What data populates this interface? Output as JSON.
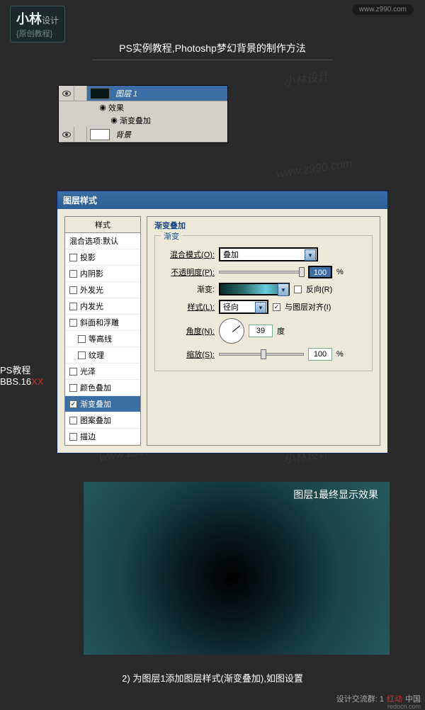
{
  "header": {
    "logo_main": "小林",
    "logo_sub": "设计",
    "logo_tag": "{原创教程}",
    "url": "www.z990.com"
  },
  "page_title": "PS实例教程,Photoshp梦幻背景的制作方法",
  "layers": {
    "layer1": "图层 1",
    "effects": "效果",
    "gradient_overlay": "渐变叠加",
    "background": "背景"
  },
  "dialog": {
    "title": "图层样式",
    "styles_header": "样式",
    "blend_options": "混合选项:默认",
    "items": {
      "drop_shadow": "投影",
      "inner_shadow": "内阴影",
      "outer_glow": "外发光",
      "inner_glow": "内发光",
      "bevel": "斜面和浮雕",
      "contour": "等高线",
      "texture": "纹理",
      "satin": "光泽",
      "color_overlay": "颜色叠加",
      "gradient_overlay": "渐变叠加",
      "pattern_overlay": "图案叠加",
      "stroke": "描边"
    },
    "section_title": "渐变叠加",
    "fieldset_label": "渐变",
    "blend_mode_label": "混合模式(O):",
    "blend_mode_value": "叠加",
    "opacity_label": "不透明度(P):",
    "opacity_value": "100",
    "percent": "%",
    "gradient_label": "渐变:",
    "reverse_label": "反向(R)",
    "style_label": "样式(L):",
    "style_value": "径向",
    "align_label": "与图层对齐(I)",
    "angle_label": "角度(N):",
    "angle_value": "39",
    "angle_unit": "度",
    "scale_label": "缩放(S):",
    "scale_value": "100"
  },
  "side": {
    "line1": "PS教程",
    "line2_a": "BBS.16",
    "line2_b": "XX"
  },
  "result_label": "图层1最终显示效果",
  "caption": "2) 为图层1添加图层样式(渐变叠加),如图设置",
  "footer": {
    "text": "设计交流群: 1",
    "brand1": "红动",
    "brand2": "中国",
    "url": "redocn.com"
  },
  "watermarks": [
    "小林设计",
    "www.z990.com"
  ]
}
